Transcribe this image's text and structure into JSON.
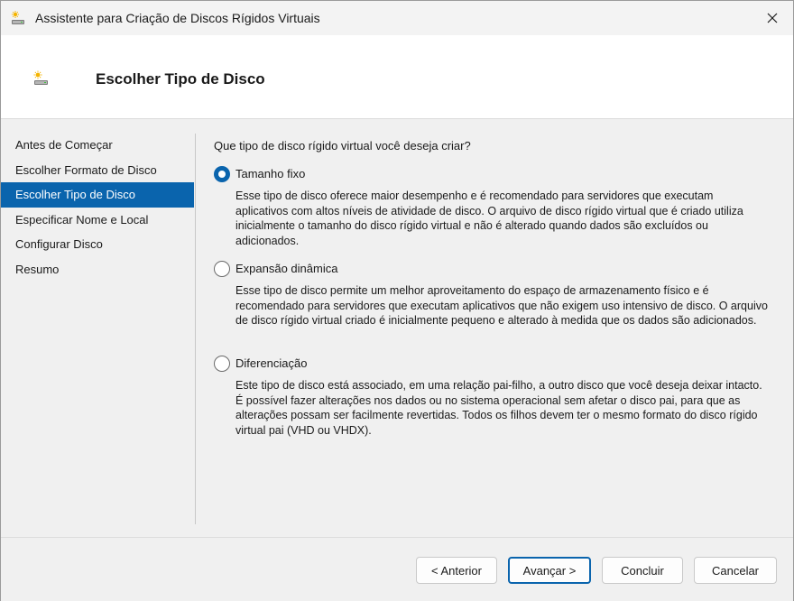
{
  "window": {
    "title": "Assistente para Criação de Discos Rígidos Virtuais"
  },
  "header": {
    "title": "Escolher Tipo de Disco"
  },
  "sidebar": {
    "items": [
      {
        "label": "Antes de Começar",
        "active": false
      },
      {
        "label": "Escolher Formato de Disco",
        "active": false
      },
      {
        "label": "Escolher Tipo de Disco",
        "active": true
      },
      {
        "label": "Especificar Nome e Local",
        "active": false
      },
      {
        "label": "Configurar Disco",
        "active": false
      },
      {
        "label": "Resumo",
        "active": false
      }
    ]
  },
  "main": {
    "question": "Que tipo de disco rígido virtual você deseja criar?",
    "options": [
      {
        "label": "Tamanho fixo",
        "checked": true,
        "description": "Esse tipo de disco oferece maior desempenho e é recomendado para servidores que executam aplicativos com altos níveis de atividade de disco. O arquivo de disco rígido virtual que é criado utiliza inicialmente o tamanho do disco rígido virtual e não é alterado quando dados são excluídos ou adicionados."
      },
      {
        "label": "Expansão dinâmica",
        "checked": false,
        "description": "Esse tipo de disco permite um melhor aproveitamento do espaço de armazenamento físico e é recomendado para servidores que executam aplicativos que não exigem uso intensivo de disco. O arquivo de disco rígido virtual criado é inicialmente pequeno e alterado à medida que os dados são adicionados."
      },
      {
        "label": "Diferenciação",
        "checked": false,
        "description": "Este tipo de disco está associado, em uma relação pai-filho, a outro disco que você deseja deixar intacto. É possível fazer alterações nos dados ou no sistema operacional sem afetar o disco pai, para que as alterações possam ser facilmente revertidas. Todos os filhos devem ter o mesmo formato do disco rígido virtual pai (VHD ou VHDX)."
      }
    ]
  },
  "footer": {
    "back_label": "< Anterior",
    "next_label": "Avançar >",
    "finish_label": "Concluir",
    "cancel_label": "Cancelar"
  },
  "icons": {
    "app": "disk-wizard-icon",
    "close": "close-icon"
  },
  "colors": {
    "accent": "#0a64ad",
    "header_bg": "#ffffff",
    "body_bg": "#f0f0f0"
  }
}
